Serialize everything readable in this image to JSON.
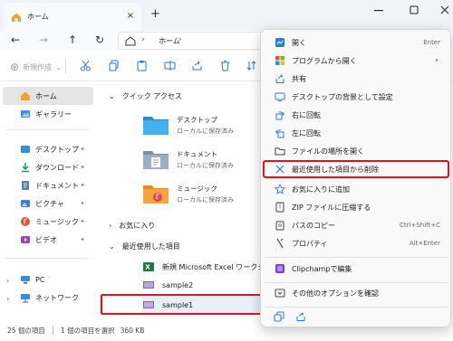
{
  "window": {
    "tab_title": "ホーム",
    "tab_close": "×",
    "new_tab": "+"
  },
  "nav": {
    "back": "←",
    "forward": "→",
    "up": "↑",
    "refresh": "↻",
    "breadcrumb": "ホーム",
    "chevron": "›"
  },
  "toolbar": {
    "new_label": "新規作成",
    "new_chevron": "⌄",
    "icons": [
      "cut-icon",
      "copy-icon",
      "paste-icon",
      "rename-icon",
      "share-icon",
      "delete-icon",
      "sort-icon"
    ]
  },
  "sidebar": {
    "items": [
      {
        "label": "ホーム",
        "icon": "home-icon"
      },
      {
        "label": "ギャラリー",
        "icon": "gallery-icon"
      },
      {
        "label": "デスクトップ",
        "icon": "desktop-icon"
      },
      {
        "label": "ダウンロード",
        "icon": "download-icon"
      },
      {
        "label": "ドキュメント",
        "icon": "documents-icon"
      },
      {
        "label": "ピクチャ",
        "icon": "pictures-icon"
      },
      {
        "label": "ミュージック",
        "icon": "music-icon"
      },
      {
        "label": "ビデオ",
        "icon": "videos-icon"
      },
      {
        "label": "PC",
        "icon": "pc-icon"
      },
      {
        "label": "ネットワーク",
        "icon": "network-icon"
      }
    ],
    "pin": "📌"
  },
  "main": {
    "quick_access_title": "クイック アクセス",
    "quick": [
      {
        "name": "デスクトップ",
        "sub": "ローカルに保存済み"
      },
      {
        "name": "ドキュメント",
        "sub": "ローカルに保存済み"
      },
      {
        "name": "ミュージック",
        "sub": "ローカルに保存済み"
      }
    ],
    "favorites_title": "お気に入り",
    "recent_title": "最近使用した項目",
    "recent": [
      {
        "name": "新規 Microsoft Excel ワークシート"
      },
      {
        "name": "sample2"
      },
      {
        "name": "sample1"
      }
    ]
  },
  "status": {
    "count": "25 個の項目",
    "selected": "1 個の項目を選択",
    "size": "360 KB"
  },
  "context_menu": {
    "items": [
      {
        "label": "開く",
        "shortcut": "Enter"
      },
      {
        "label": "プログラムから開く",
        "submenu": "›"
      },
      {
        "label": "共有"
      },
      {
        "label": "デスクトップの背景として設定"
      },
      {
        "label": "右に回転"
      },
      {
        "label": "左に回転"
      },
      {
        "label": "ファイルの場所を開く"
      },
      {
        "label": "最近使用した項目から削除"
      },
      {
        "label": "お気に入りに追加"
      },
      {
        "label": "ZIP ファイルに圧縮する"
      },
      {
        "label": "パスのコピー",
        "shortcut": "Ctrl+Shift+C"
      },
      {
        "label": "プロパティ",
        "shortcut": "Alt+Enter"
      },
      {
        "label": "Clipchampで編集"
      },
      {
        "label": "その他のオプションを確認"
      }
    ]
  },
  "colors": {
    "highlight_border": "#e8101a",
    "accent": "#0a64c8"
  }
}
